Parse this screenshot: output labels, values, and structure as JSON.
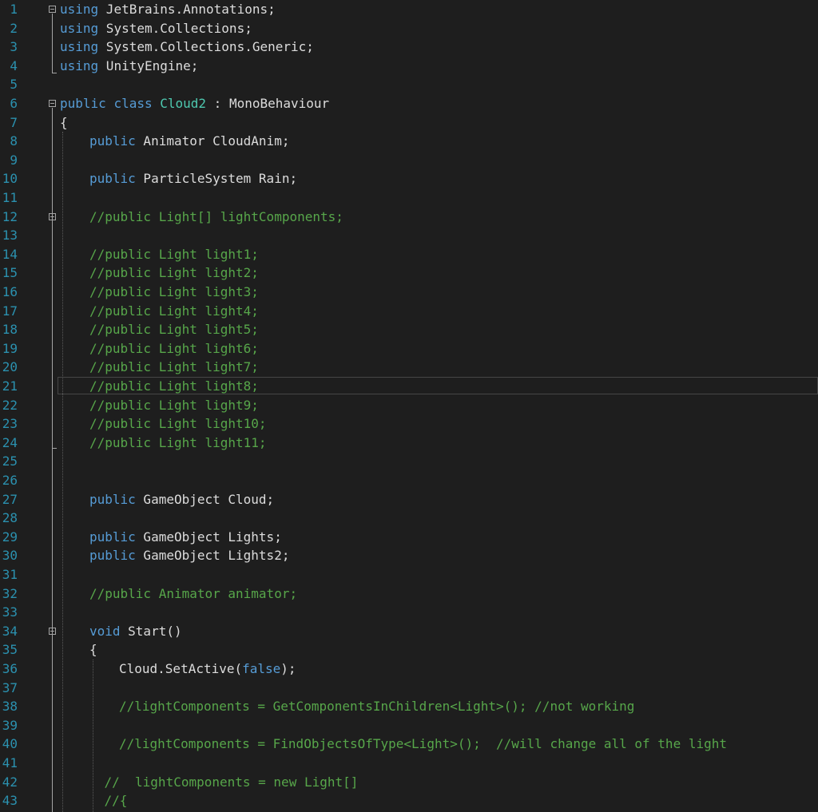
{
  "editor": {
    "language": "csharp",
    "colors": {
      "background": "#1e1e1e",
      "line_number": "#2b91af",
      "keyword": "#569cd6",
      "type": "#4ec9b0",
      "comment": "#57a64a",
      "plain": "#dcdcdc"
    },
    "lines": [
      {
        "n": "1",
        "indent": 0,
        "tokens": [
          [
            "k",
            "using"
          ],
          [
            "p",
            " JetBrains.Annotations;"
          ]
        ]
      },
      {
        "n": "2",
        "indent": 0,
        "tokens": [
          [
            "k",
            "using"
          ],
          [
            "p",
            " System.Collections;"
          ]
        ]
      },
      {
        "n": "3",
        "indent": 0,
        "tokens": [
          [
            "k",
            "using"
          ],
          [
            "p",
            " System.Collections.Generic;"
          ]
        ]
      },
      {
        "n": "4",
        "indent": 0,
        "tokens": [
          [
            "k",
            "using"
          ],
          [
            "p",
            " UnityEngine;"
          ]
        ]
      },
      {
        "n": "5",
        "indent": 0,
        "tokens": []
      },
      {
        "n": "6",
        "indent": 0,
        "tokens": [
          [
            "k",
            "public"
          ],
          [
            "p",
            " "
          ],
          [
            "k",
            "class"
          ],
          [
            "p",
            " "
          ],
          [
            "t",
            "Cloud2"
          ],
          [
            "p",
            " : MonoBehaviour"
          ]
        ]
      },
      {
        "n": "7",
        "indent": 0,
        "tokens": [
          [
            "p",
            "{"
          ]
        ]
      },
      {
        "n": "8",
        "indent": 1,
        "tokens": [
          [
            "k",
            "public"
          ],
          [
            "p",
            " Animator CloudAnim;"
          ]
        ]
      },
      {
        "n": "9",
        "indent": 0,
        "tokens": []
      },
      {
        "n": "10",
        "indent": 1,
        "tokens": [
          [
            "k",
            "public"
          ],
          [
            "p",
            " ParticleSystem Rain;"
          ]
        ]
      },
      {
        "n": "11",
        "indent": 0,
        "tokens": []
      },
      {
        "n": "12",
        "indent": 1,
        "tokens": [
          [
            "c",
            "//public Light[] lightComponents;"
          ]
        ]
      },
      {
        "n": "13",
        "indent": 0,
        "tokens": []
      },
      {
        "n": "14",
        "indent": 1,
        "tokens": [
          [
            "c",
            "//public Light light1;"
          ]
        ]
      },
      {
        "n": "15",
        "indent": 1,
        "tokens": [
          [
            "c",
            "//public Light light2;"
          ]
        ]
      },
      {
        "n": "16",
        "indent": 1,
        "tokens": [
          [
            "c",
            "//public Light light3;"
          ]
        ]
      },
      {
        "n": "17",
        "indent": 1,
        "tokens": [
          [
            "c",
            "//public Light light4;"
          ]
        ]
      },
      {
        "n": "18",
        "indent": 1,
        "tokens": [
          [
            "c",
            "//public Light light5;"
          ]
        ]
      },
      {
        "n": "19",
        "indent": 1,
        "tokens": [
          [
            "c",
            "//public Light light6;"
          ]
        ]
      },
      {
        "n": "20",
        "indent": 1,
        "tokens": [
          [
            "c",
            "//public Light light7;"
          ]
        ]
      },
      {
        "n": "21",
        "indent": 1,
        "tokens": [
          [
            "c",
            "//public Light light8;"
          ]
        ]
      },
      {
        "n": "22",
        "indent": 1,
        "tokens": [
          [
            "c",
            "//public Light light9;"
          ]
        ]
      },
      {
        "n": "23",
        "indent": 1,
        "tokens": [
          [
            "c",
            "//public Light light10;"
          ]
        ]
      },
      {
        "n": "24",
        "indent": 1,
        "tokens": [
          [
            "c",
            "//public Light light11;"
          ]
        ]
      },
      {
        "n": "25",
        "indent": 0,
        "tokens": []
      },
      {
        "n": "26",
        "indent": 0,
        "tokens": []
      },
      {
        "n": "27",
        "indent": 1,
        "tokens": [
          [
            "k",
            "public"
          ],
          [
            "p",
            " GameObject Cloud;"
          ]
        ]
      },
      {
        "n": "28",
        "indent": 0,
        "tokens": []
      },
      {
        "n": "29",
        "indent": 1,
        "tokens": [
          [
            "k",
            "public"
          ],
          [
            "p",
            " GameObject Lights;"
          ]
        ]
      },
      {
        "n": "30",
        "indent": 1,
        "tokens": [
          [
            "k",
            "public"
          ],
          [
            "p",
            " GameObject Lights2;"
          ]
        ]
      },
      {
        "n": "31",
        "indent": 0,
        "tokens": []
      },
      {
        "n": "32",
        "indent": 1,
        "tokens": [
          [
            "c",
            "//public Animator animator;"
          ]
        ]
      },
      {
        "n": "33",
        "indent": 0,
        "tokens": []
      },
      {
        "n": "34",
        "indent": 1,
        "tokens": [
          [
            "k",
            "void"
          ],
          [
            "p",
            " Start()"
          ]
        ]
      },
      {
        "n": "35",
        "indent": 1,
        "tokens": [
          [
            "p",
            "{"
          ]
        ]
      },
      {
        "n": "36",
        "indent": 2,
        "tokens": [
          [
            "p",
            "Cloud.SetActive("
          ],
          [
            "k",
            "false"
          ],
          [
            "p",
            ");"
          ]
        ]
      },
      {
        "n": "37",
        "indent": 0,
        "tokens": []
      },
      {
        "n": "38",
        "indent": 2,
        "tokens": [
          [
            "c",
            "//lightComponents = GetComponentsInChildren<Light>(); //not working"
          ]
        ]
      },
      {
        "n": "39",
        "indent": 0,
        "tokens": []
      },
      {
        "n": "40",
        "indent": 2,
        "tokens": [
          [
            "c",
            "//lightComponents = FindObjectsOfType<Light>();  //will change all of the light"
          ]
        ]
      },
      {
        "n": "41",
        "indent": 0,
        "tokens": []
      },
      {
        "n": "42",
        "indent": 1.5,
        "tokens": [
          [
            "c",
            "//  lightComponents = new Light[]"
          ]
        ]
      },
      {
        "n": "43",
        "indent": 1.5,
        "tokens": [
          [
            "c",
            "//{"
          ]
        ]
      }
    ]
  }
}
